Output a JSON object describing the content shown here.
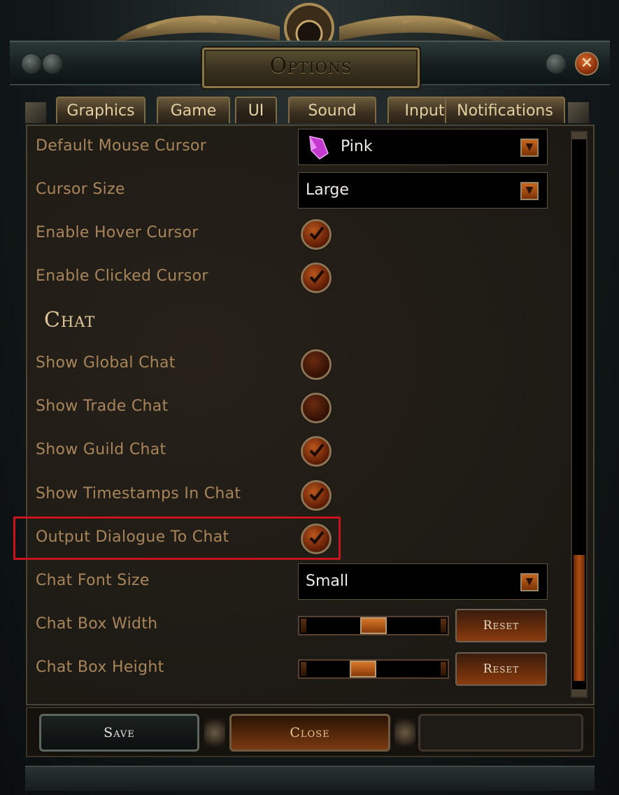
{
  "window": {
    "title": "Options",
    "close_glyph": "×"
  },
  "tabs": [
    {
      "label": "Graphics"
    },
    {
      "label": "Game"
    },
    {
      "label": "UI"
    },
    {
      "label": "Sound"
    },
    {
      "label": "Input"
    },
    {
      "label": "Notifications"
    }
  ],
  "active_tab": "UI",
  "settings": {
    "default_mouse_cursor": {
      "label": "Default Mouse Cursor",
      "value": "Pink",
      "icon": "pink-gem-icon"
    },
    "cursor_size": {
      "label": "Cursor Size",
      "value": "Large"
    },
    "enable_hover_cursor": {
      "label": "Enable Hover Cursor",
      "checked": true
    },
    "enable_clicked_cursor": {
      "label": "Enable Clicked Cursor",
      "checked": true
    }
  },
  "chat": {
    "heading": "Chat",
    "show_global_chat": {
      "label": "Show Global Chat",
      "checked": false
    },
    "show_trade_chat": {
      "label": "Show Trade Chat",
      "checked": false
    },
    "show_guild_chat": {
      "label": "Show Guild Chat",
      "checked": true
    },
    "show_timestamps": {
      "label": "Show Timestamps In Chat",
      "checked": true
    },
    "output_dialogue": {
      "label": "Output Dialogue To Chat",
      "checked": true
    },
    "chat_font_size": {
      "label": "Chat Font Size",
      "value": "Small"
    },
    "chat_box_width": {
      "label": "Chat Box Width",
      "reset_label": "Reset",
      "level": 0.5
    },
    "chat_box_height": {
      "label": "Chat Box Height",
      "reset_label": "Reset",
      "level": 0.4
    }
  },
  "footer": {
    "save_label": "Save",
    "close_label": "Close"
  },
  "colors": {
    "label": "#a8855a",
    "accent_orange": "#c8661e",
    "highlight_box": "#c8141e"
  }
}
